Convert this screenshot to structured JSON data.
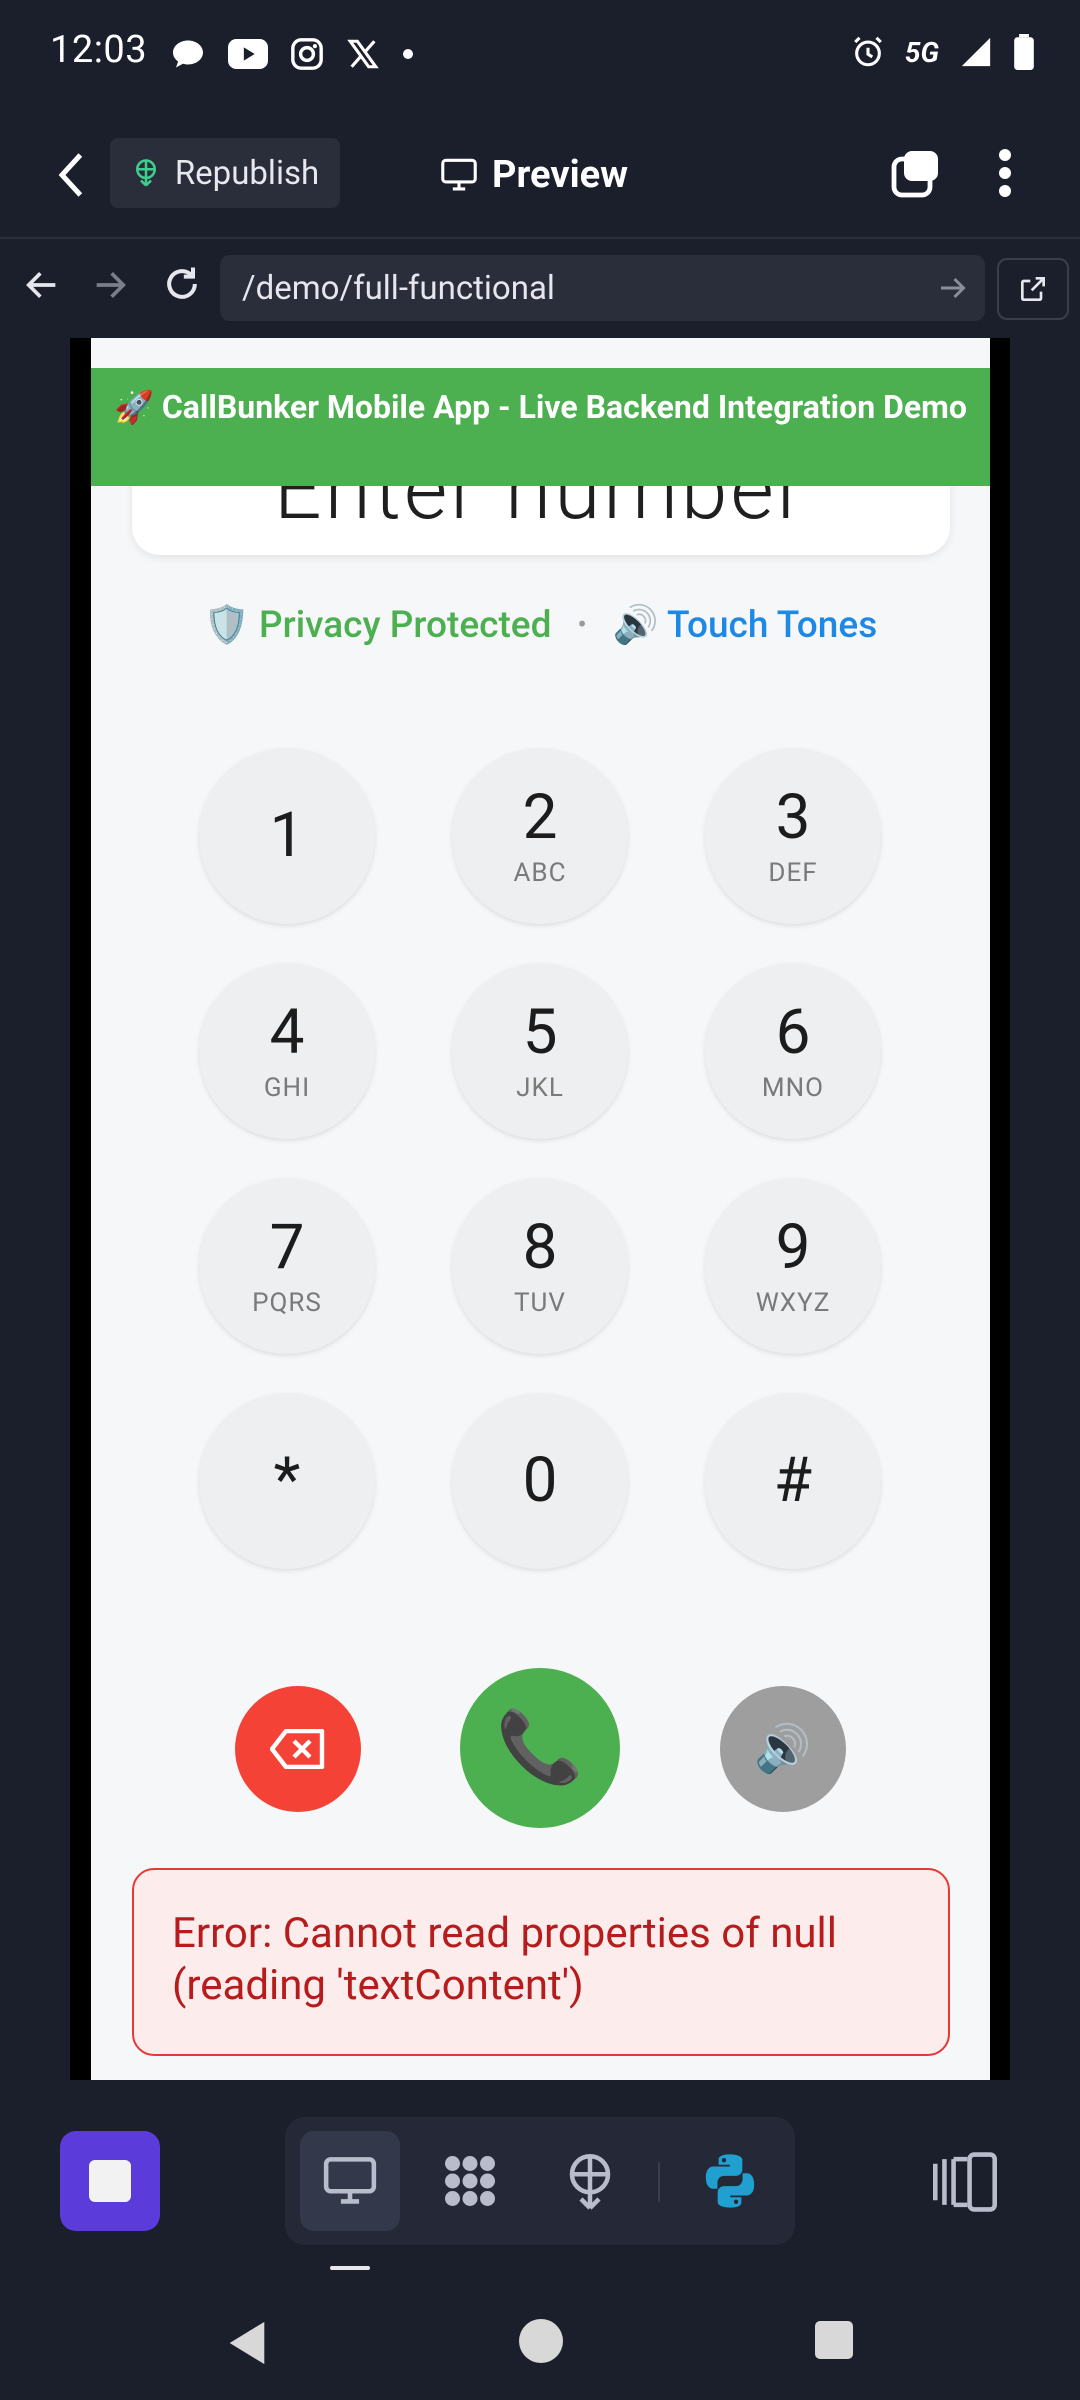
{
  "status_bar": {
    "time": "12:03",
    "left_icons": [
      "chat-bubble-icon",
      "youtube-icon",
      "instagram-icon",
      "x-icon",
      "dot-icon"
    ],
    "right_icons": [
      "alarm-icon",
      "5g-icon",
      "signal-icon",
      "battery-icon"
    ],
    "network": "5G"
  },
  "app_header": {
    "back_icon": "chevron-left-icon",
    "republish_label": "Republish",
    "preview_label": "Preview",
    "tabs_icon": "tabs-icon",
    "menu_icon": "kebab-menu-icon"
  },
  "browser": {
    "url": "/demo/full-functional"
  },
  "page": {
    "banner": "🚀 CallBunker Mobile App - Live Backend Integration Demo",
    "number_placeholder": "Enter number",
    "privacy_label": "🛡️ Privacy Protected",
    "separator": "•",
    "tones_label": "🔊 Touch Tones",
    "keys": [
      {
        "digit": "1",
        "letters": ""
      },
      {
        "digit": "2",
        "letters": "ABC"
      },
      {
        "digit": "3",
        "letters": "DEF"
      },
      {
        "digit": "4",
        "letters": "GHI"
      },
      {
        "digit": "5",
        "letters": "JKL"
      },
      {
        "digit": "6",
        "letters": "MNO"
      },
      {
        "digit": "7",
        "letters": "PQRS"
      },
      {
        "digit": "8",
        "letters": "TUV"
      },
      {
        "digit": "9",
        "letters": "WXYZ"
      },
      {
        "digit": "*",
        "letters": ""
      },
      {
        "digit": "0",
        "letters": ""
      },
      {
        "digit": "#",
        "letters": ""
      }
    ],
    "call_icon": "📞",
    "speaker_icon": "🔊",
    "error_text": "Error: Cannot read properties of null (reading 'textContent')",
    "colors": {
      "banner": "#4caf50",
      "privacy": "#4caf50",
      "tones": "#1e88e5",
      "delete_button": "#f44336",
      "call_button": "#4caf50",
      "speaker_button": "#9e9e9e",
      "error": "#b71c1c"
    }
  },
  "bottom_toolbar": {
    "stop_icon": "stop-square-icon",
    "tools": [
      "desktop-icon",
      "tools-grid-icon",
      "deploy-icon",
      "python-icon"
    ],
    "dock_icon": "dock-panel-icon"
  },
  "system_nav": [
    "back-triangle-icon",
    "home-circle-icon",
    "recents-square-icon"
  ]
}
